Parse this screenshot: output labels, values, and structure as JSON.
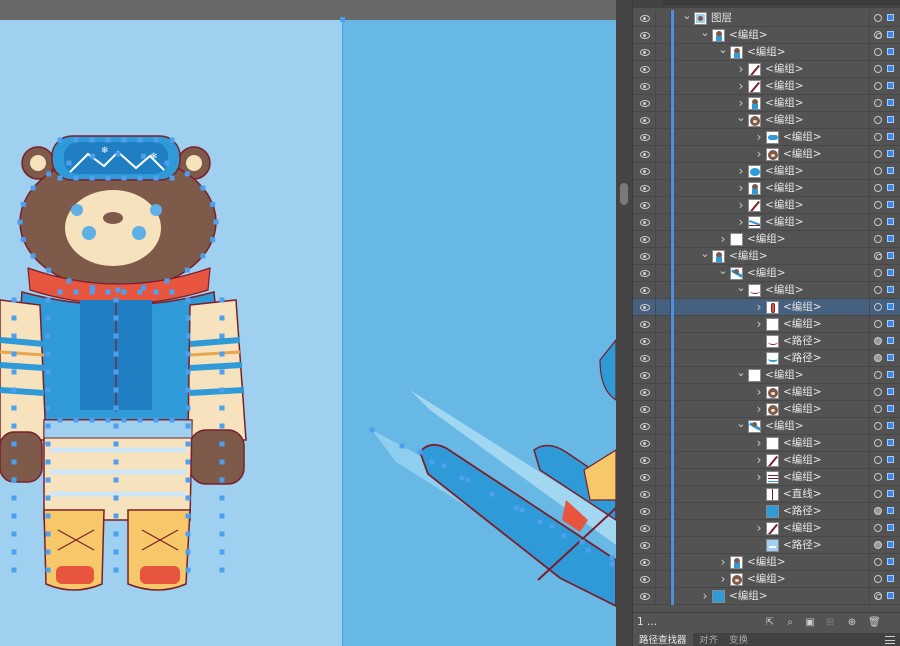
{
  "panel": {
    "root_layer": "图层",
    "layer_count": "1 ...",
    "tabs": [
      "路径查找器",
      "对齐",
      "变换"
    ],
    "rows": [
      {
        "indent": 0,
        "chev": "v",
        "name": "图层",
        "thumb": "layer",
        "target": "ring",
        "sel": true
      },
      {
        "indent": 1,
        "chev": "v",
        "name": "<编组>",
        "thumb": "bear-small",
        "target": "dbl",
        "sel": true
      },
      {
        "indent": 2,
        "chev": "v",
        "name": "<编组>",
        "thumb": "bear-small",
        "target": "ring",
        "sel": true
      },
      {
        "indent": 3,
        "chev": ">",
        "name": "<编组>",
        "thumb": "stroke-red",
        "target": "ring",
        "sel": true
      },
      {
        "indent": 3,
        "chev": ">",
        "name": "<编组>",
        "thumb": "stroke-red",
        "target": "ring",
        "sel": true
      },
      {
        "indent": 3,
        "chev": ">",
        "name": "<编组>",
        "thumb": "bear-small",
        "target": "ring",
        "sel": true
      },
      {
        "indent": 3,
        "chev": "v",
        "name": "<编组>",
        "thumb": "bear-face",
        "target": "ring",
        "sel": true
      },
      {
        "indent": 4,
        "chev": ">",
        "name": "<编组>",
        "thumb": "goggle",
        "target": "ring",
        "sel": true
      },
      {
        "indent": 4,
        "chev": ">",
        "name": "<编组>",
        "thumb": "bear-face",
        "target": "ring",
        "sel": true
      },
      {
        "indent": 3,
        "chev": ">",
        "name": "<编组>",
        "thumb": "blue-blob",
        "target": "ring",
        "sel": true
      },
      {
        "indent": 3,
        "chev": ">",
        "name": "<编组>",
        "thumb": "bear-small",
        "target": "ring",
        "sel": true
      },
      {
        "indent": 3,
        "chev": ">",
        "name": "<编组>",
        "thumb": "stroke-red",
        "target": "ring",
        "sel": true
      },
      {
        "indent": 3,
        "chev": ">",
        "name": "<编组>",
        "thumb": "stroke-blue",
        "target": "ring",
        "sel": true
      },
      {
        "indent": 2,
        "chev": ">",
        "name": "<编组>",
        "thumb": "white",
        "target": "ring",
        "sel": true
      },
      {
        "indent": 1,
        "chev": "v",
        "name": "<编组>",
        "thumb": "bear-small",
        "target": "dbl",
        "sel": true
      },
      {
        "indent": 2,
        "chev": "v",
        "name": "<编组>",
        "thumb": "ski",
        "target": "ring",
        "sel": true
      },
      {
        "indent": 3,
        "chev": "v",
        "name": "<编组>",
        "thumb": "curve",
        "target": "ring",
        "sel": true
      },
      {
        "indent": 4,
        "chev": ">",
        "name": "<编组>",
        "thumb": "red-knot",
        "target": "ring",
        "sel": true,
        "selected": true
      },
      {
        "indent": 4,
        "chev": ">",
        "name": "<编组>",
        "thumb": "white",
        "target": "ring",
        "sel": true
      },
      {
        "indent": 4,
        "chev": "",
        "name": "<路径>",
        "thumb": "curve",
        "target": "fill",
        "sel": true
      },
      {
        "indent": 4,
        "chev": "",
        "name": "<路径>",
        "thumb": "curve-blue",
        "target": "fill",
        "sel": true
      },
      {
        "indent": 3,
        "chev": "v",
        "name": "<编组>",
        "thumb": "white",
        "target": "ring",
        "sel": true
      },
      {
        "indent": 4,
        "chev": ">",
        "name": "<编组>",
        "thumb": "bear-face",
        "target": "ring",
        "sel": true
      },
      {
        "indent": 4,
        "chev": ">",
        "name": "<编组>",
        "thumb": "bear-face",
        "target": "ring",
        "sel": true
      },
      {
        "indent": 3,
        "chev": "v",
        "name": "<编组>",
        "thumb": "ski",
        "target": "ring",
        "sel": true
      },
      {
        "indent": 4,
        "chev": ">",
        "name": "<编组>",
        "thumb": "white",
        "target": "ring",
        "sel": true
      },
      {
        "indent": 4,
        "chev": ">",
        "name": "<编组>",
        "thumb": "stroke-red",
        "target": "ring",
        "sel": true
      },
      {
        "indent": 4,
        "chev": ">",
        "name": "<编组>",
        "thumb": "lines",
        "target": "ring",
        "sel": true
      },
      {
        "indent": 4,
        "chev": "",
        "name": "<直线>",
        "thumb": "vline",
        "target": "ring",
        "sel": true
      },
      {
        "indent": 4,
        "chev": "",
        "name": "<路径>",
        "thumb": "blue-fill",
        "target": "fill",
        "sel": true
      },
      {
        "indent": 4,
        "chev": ">",
        "name": "<编组>",
        "thumb": "stroke-red",
        "target": "ring",
        "sel": true
      },
      {
        "indent": 4,
        "chev": "",
        "name": "<路径>",
        "thumb": "blue-light",
        "target": "fill",
        "sel": true
      },
      {
        "indent": 2,
        "chev": ">",
        "name": "<编组>",
        "thumb": "bear-small",
        "target": "ring",
        "sel": true
      },
      {
        "indent": 2,
        "chev": ">",
        "name": "<编组>",
        "thumb": "bear-face",
        "target": "ring",
        "sel": true
      },
      {
        "indent": 1,
        "chev": ">",
        "name": "<编组>",
        "thumb": "blue-fill",
        "target": "dbl",
        "sel": true
      }
    ]
  },
  "colors": {
    "artboard_left": "#9fd0ef",
    "artboard_right": "#67b8e4",
    "selection": "#4d9ff0",
    "bear_brown": "#7e5a4a",
    "jacket_blue": "#2f9ad8",
    "cream": "#f6e2bc",
    "outline": "#7a1f2a",
    "accent_red": "#e8553f"
  },
  "icons": [
    "eye-icon",
    "chevron-icon",
    "target-icon",
    "export-icon",
    "search-icon",
    "clip-icon",
    "new-sublayer-icon",
    "new-layer-icon",
    "trash-icon",
    "panel-menu-icon"
  ]
}
